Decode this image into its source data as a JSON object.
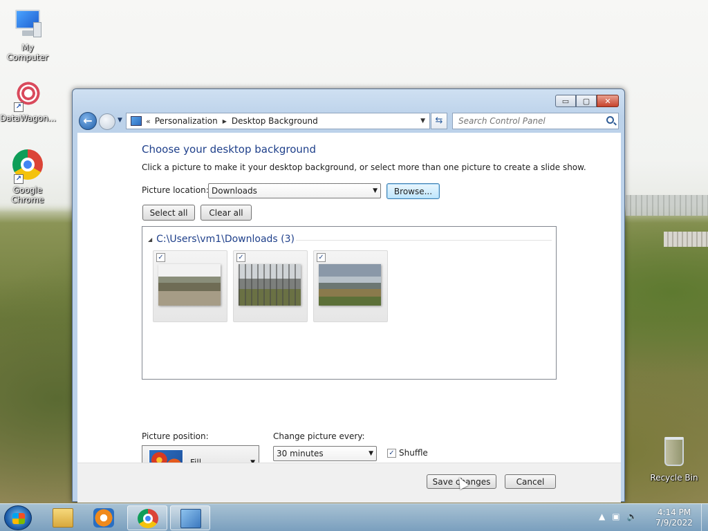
{
  "desktop": {
    "icons": [
      {
        "label": "My Computer"
      },
      {
        "label": "DataWagon..."
      },
      {
        "label": "Google Chrome"
      },
      {
        "label": "Recycle Bin"
      }
    ]
  },
  "window": {
    "caption_buttons": {
      "minimize": "▭",
      "maximize": "▢",
      "close": "✕"
    },
    "address": {
      "overflow": "«",
      "crumbs": [
        "Personalization",
        "Desktop Background"
      ]
    },
    "search": {
      "placeholder": "Search Control Panel"
    },
    "page": {
      "title": "Choose your desktop background",
      "description": "Click a picture to make it your desktop background, or select more than one picture to create a slide show.",
      "picture_location_label": "Picture location:",
      "picture_location_value": "Downloads",
      "browse_button": "Browse...",
      "select_all_button": "Select all",
      "clear_all_button": "Clear all",
      "folder_header": "C:\\Users\\vm1\\Downloads (3)",
      "thumbnails": [
        {
          "checked": true,
          "check_glyph": "✓"
        },
        {
          "checked": true,
          "check_glyph": "✓"
        },
        {
          "checked": true,
          "check_glyph": "✓"
        }
      ],
      "picture_position_label": "Picture position:",
      "picture_position_value": "Fill",
      "change_every_label": "Change picture every:",
      "change_every_value": "30 minutes",
      "shuffle_label": "Shuffle",
      "shuffle_checked": true,
      "shuffle_glyph": "✓"
    },
    "footer": {
      "save_button": "Save changes",
      "cancel_button": "Cancel"
    }
  },
  "taskbar": {
    "clock": {
      "time": "4:14 PM",
      "date": "7/9/2022"
    },
    "tray_icons": [
      "show-hidden-icons-arrow",
      "network-icon",
      "volume-icon"
    ]
  },
  "colors": {
    "title_blue": "#1e3f8a",
    "focus_button": "#3c7fb1"
  }
}
